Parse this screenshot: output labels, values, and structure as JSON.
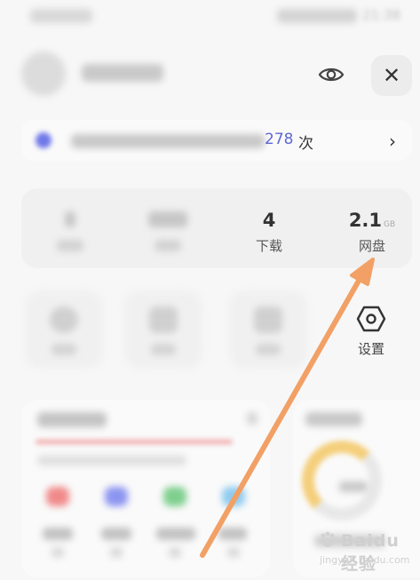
{
  "status_bar": {
    "time": "21:38"
  },
  "profile": {
    "username": ""
  },
  "banner": {
    "count": "278",
    "unit": "次"
  },
  "stats": [
    {
      "value": "",
      "label": ""
    },
    {
      "value": "",
      "label": ""
    },
    {
      "value": "4",
      "label": "下载",
      "unit": ""
    },
    {
      "value": "2.1",
      "unit": "GB",
      "label": "网盘"
    }
  ],
  "tools": {
    "settings_label": "设置"
  },
  "watermark": {
    "text": "Baidu经验",
    "sub": "jingyan.baidu.com"
  },
  "colors": {
    "accent": "#5d68d6",
    "annotation_arrow": "#f2a065",
    "progress_ring": "#f4cf7c",
    "app_icons": [
      "#f08a8a",
      "#8c95f0",
      "#7fcf8e",
      "#8fcbef"
    ]
  },
  "icons": {
    "eye": "eye-icon",
    "close": "close-icon",
    "chevron": "chevron-right-icon",
    "settings": "hexagon-settings-icon"
  }
}
